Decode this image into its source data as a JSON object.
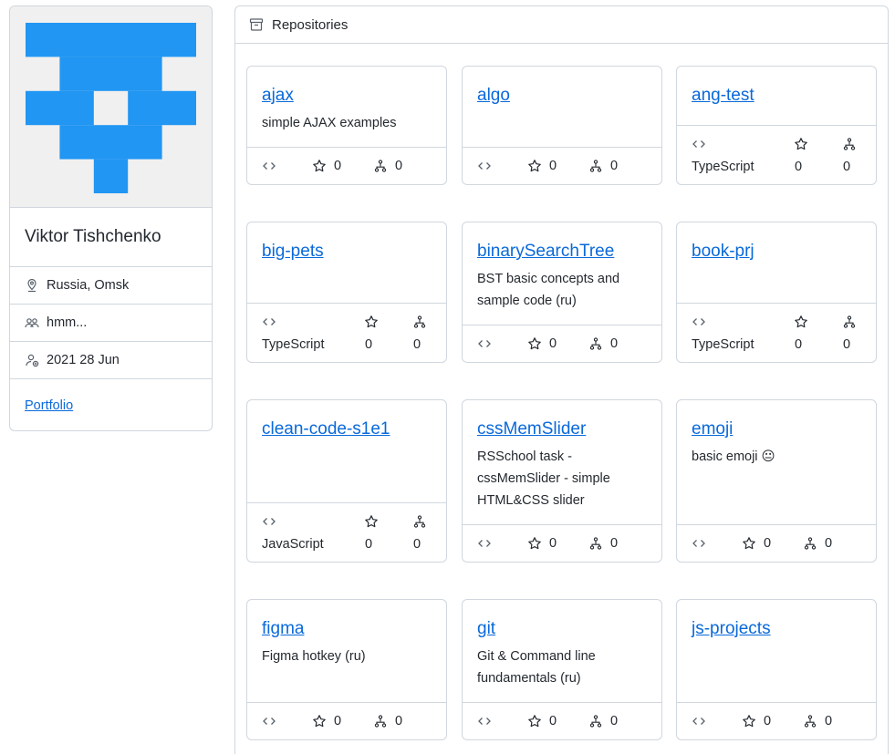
{
  "profile": {
    "name": "Viktor Tishchenko",
    "location": "Russia, Omsk",
    "followers": "hmm...",
    "joined": "2021 28 Jun",
    "link": "Portfolio",
    "avatar_color": "#2196f3"
  },
  "repos_header": {
    "title": "Repositories",
    "icon": "repo-icon"
  },
  "repos": [
    {
      "name": "ajax",
      "desc": "simple AJAX examples",
      "lang": "",
      "stars": "0",
      "forks": "0"
    },
    {
      "name": "algo",
      "desc": "",
      "lang": "",
      "stars": "0",
      "forks": "0"
    },
    {
      "name": "ang-test",
      "desc": "",
      "lang": "TypeScript",
      "stars": "0",
      "forks": "0"
    },
    {
      "name": "big-pets",
      "desc": "",
      "lang": "TypeScript",
      "stars": "0",
      "forks": "0"
    },
    {
      "name": "binarySearchTree",
      "desc": "BST basic concepts and sample code (ru)",
      "lang": "",
      "stars": "0",
      "forks": "0"
    },
    {
      "name": "book-prj",
      "desc": "",
      "lang": "TypeScript",
      "stars": "0",
      "forks": "0"
    },
    {
      "name": "clean-code-s1e1",
      "desc": "",
      "lang": "JavaScript",
      "stars": "0",
      "forks": "0"
    },
    {
      "name": "cssMemSlider",
      "desc": "RSSchool task - cssMemSlider - simple HTML&CSS slider",
      "lang": "",
      "stars": "0",
      "forks": "0"
    },
    {
      "name": "emoji",
      "desc": "basic emoji 😐",
      "lang": "",
      "stars": "0",
      "forks": "0"
    },
    {
      "name": "figma",
      "desc": "Figma hotkey (ru)",
      "lang": "",
      "stars": "0",
      "forks": "0"
    },
    {
      "name": "git",
      "desc": "Git & Command line fundamentals (ru)",
      "lang": "",
      "stars": "0",
      "forks": "0"
    },
    {
      "name": "js-projects",
      "desc": "",
      "lang": "",
      "stars": "0",
      "forks": "0"
    }
  ],
  "colors": {
    "link": "#0969da",
    "border": "#d0d7de",
    "text": "#24292f"
  }
}
